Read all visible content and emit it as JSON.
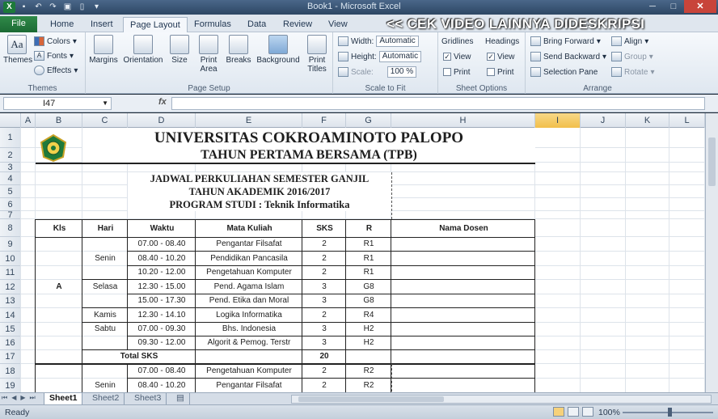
{
  "window": {
    "caption": "Book1 - Microsoft Excel",
    "watermark": "<< CEK VIDEO LAINNYA DIDESKRIPSI"
  },
  "tabs": [
    "File",
    "Home",
    "Insert",
    "Page Layout",
    "Formulas",
    "Data",
    "Review",
    "View"
  ],
  "active_tab": "Page Layout",
  "ribbon": {
    "themes": {
      "label": "Themes",
      "button": "Themes",
      "colors": "Colors",
      "fonts": "Fonts",
      "effects": "Effects"
    },
    "page_setup": {
      "label": "Page Setup",
      "margins": "Margins",
      "orientation": "Orientation",
      "size": "Size",
      "print_area": "Print Area",
      "breaks": "Breaks",
      "background": "Background",
      "print_titles": "Print Titles"
    },
    "scale_to_fit": {
      "label": "Scale to Fit",
      "width_label": "Width:",
      "width_value": "Automatic",
      "height_label": "Height:",
      "height_value": "Automatic",
      "scale_label": "Scale:",
      "scale_value": "100 %"
    },
    "sheet_options": {
      "label": "Sheet Options",
      "gridlines": "Gridlines",
      "headings": "Headings",
      "view": "View",
      "print": "Print"
    },
    "arrange": {
      "label": "Arrange",
      "bring_forward": "Bring Forward",
      "send_backward": "Send Backward",
      "selection_pane": "Selection Pane",
      "align": "Align",
      "group": "Group",
      "rotate": "Rotate"
    }
  },
  "formula_bar": {
    "name_box": "I47",
    "fx": "fx",
    "value": ""
  },
  "columns": [
    "A",
    "B",
    "C",
    "D",
    "E",
    "F",
    "G",
    "H",
    "I",
    "J",
    "K",
    "L"
  ],
  "selected_column": "I",
  "rows": [
    "1",
    "2",
    "3",
    "4",
    "5",
    "6",
    "7",
    "8",
    "9",
    "10",
    "11",
    "12",
    "13",
    "14",
    "15",
    "16",
    "17",
    "18",
    "19"
  ],
  "header": {
    "university": "UNIVERSITAS COKROAMINOTO PALOPO",
    "program_year": "TAHUN PERTAMA BERSAMA (TPB)",
    "schedule": "JADWAL PERKULIAHAN SEMESTER GANJIL",
    "academic_year": "TAHUN AKADEMIK 2016/2017",
    "study_program": "PROGRAM STUDI  :  Teknik Informatika"
  },
  "table": {
    "headers": [
      "Kls",
      "Hari",
      "Waktu",
      "Mata Kuliah",
      "SKS",
      "R",
      "Nama Dosen"
    ],
    "class_label": "A",
    "days": {
      "senin": "Senin",
      "selasa": "Selasa",
      "kamis": "Kamis",
      "sabtu": "Sabtu",
      "senin2": "Senin"
    },
    "rows": [
      {
        "waktu": "07.00 - 08.40",
        "mk": "Pengantar Filsafat",
        "sks": "2",
        "r": "R1"
      },
      {
        "waktu": "08.40 - 10.20",
        "mk": "Pendidikan Pancasila",
        "sks": "2",
        "r": "R1"
      },
      {
        "waktu": "10.20 - 12.00",
        "mk": "Pengetahuan Komputer",
        "sks": "2",
        "r": "R1"
      },
      {
        "waktu": "12.30 - 15.00",
        "mk": "Pend. Agama Islam",
        "sks": "3",
        "r": "G8"
      },
      {
        "waktu": "15.00 - 17.30",
        "mk": "Pend. Etika dan Moral",
        "sks": "3",
        "r": "G8"
      },
      {
        "waktu": "12.30 - 14.10",
        "mk": "Logika Informatika",
        "sks": "2",
        "r": "R4"
      },
      {
        "waktu": "07.00 - 09.30",
        "mk": "Bhs. Indonesia",
        "sks": "3",
        "r": "H2"
      },
      {
        "waktu": "09.30 - 12.00",
        "mk": "Algorit & Pemog. Terstr",
        "sks": "3",
        "r": "H2"
      }
    ],
    "total_label": "Total  SKS",
    "total_value": "20",
    "rows2": [
      {
        "waktu": "07.00 - 08.40",
        "mk": "Pengetahuan Komputer",
        "sks": "2",
        "r": "R2"
      },
      {
        "waktu": "08.40 - 10.20",
        "mk": "Pengantar Filsafat",
        "sks": "2",
        "r": "R2"
      }
    ]
  },
  "sheet_tabs": [
    "Sheet1",
    "Sheet2",
    "Sheet3"
  ],
  "active_sheet": "Sheet1",
  "status": {
    "ready": "Ready",
    "zoom": "100%"
  }
}
